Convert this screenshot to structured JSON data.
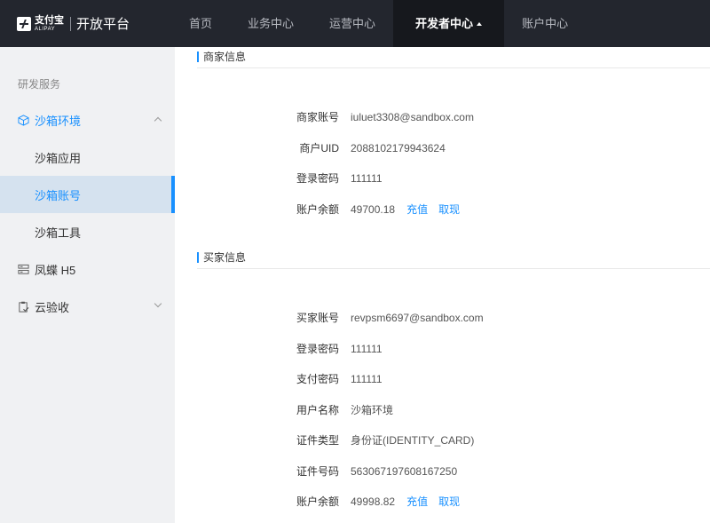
{
  "header": {
    "logo_cn": "支付宝",
    "logo_en": "ALIPAY",
    "platform_title": "开放平台",
    "nav": [
      "首页",
      "业务中心",
      "运营中心",
      "开发者中心",
      "账户中心"
    ]
  },
  "sidebar": {
    "section": "研发服务",
    "items": [
      {
        "label": "沙箱环境",
        "icon": "cube-icon"
      },
      {
        "label": "沙箱应用"
      },
      {
        "label": "沙箱账号"
      },
      {
        "label": "沙箱工具"
      },
      {
        "label": "凤蝶 H5",
        "icon": "server-icon"
      },
      {
        "label": "云验收",
        "icon": "clipboard-check-icon"
      }
    ]
  },
  "merchant": {
    "title": "商家信息",
    "fields": [
      {
        "label": "商家账号",
        "value": "iuluet3308@sandbox.com"
      },
      {
        "label": "商户UID",
        "value": "2088102179943624"
      },
      {
        "label": "登录密码",
        "value": "111111"
      },
      {
        "label": "账户余额",
        "value": "49700.18",
        "links": [
          "充值",
          "取现"
        ]
      }
    ]
  },
  "buyer": {
    "title": "买家信息",
    "fields": [
      {
        "label": "买家账号",
        "value": "revpsm6697@sandbox.com"
      },
      {
        "label": "登录密码",
        "value": "111111"
      },
      {
        "label": "支付密码",
        "value": "111111"
      },
      {
        "label": "用户名称",
        "value": "沙箱环境"
      },
      {
        "label": "证件类型",
        "value": "身份证(IDENTITY_CARD)"
      },
      {
        "label": "证件号码",
        "value": "563067197608167250"
      },
      {
        "label": "账户余额",
        "value": "49998.82",
        "links": [
          "充值",
          "取现"
        ]
      }
    ]
  },
  "colors": {
    "accent": "#1890ff",
    "topbar": "#23262e",
    "sidebar": "#f0f1f3"
  }
}
